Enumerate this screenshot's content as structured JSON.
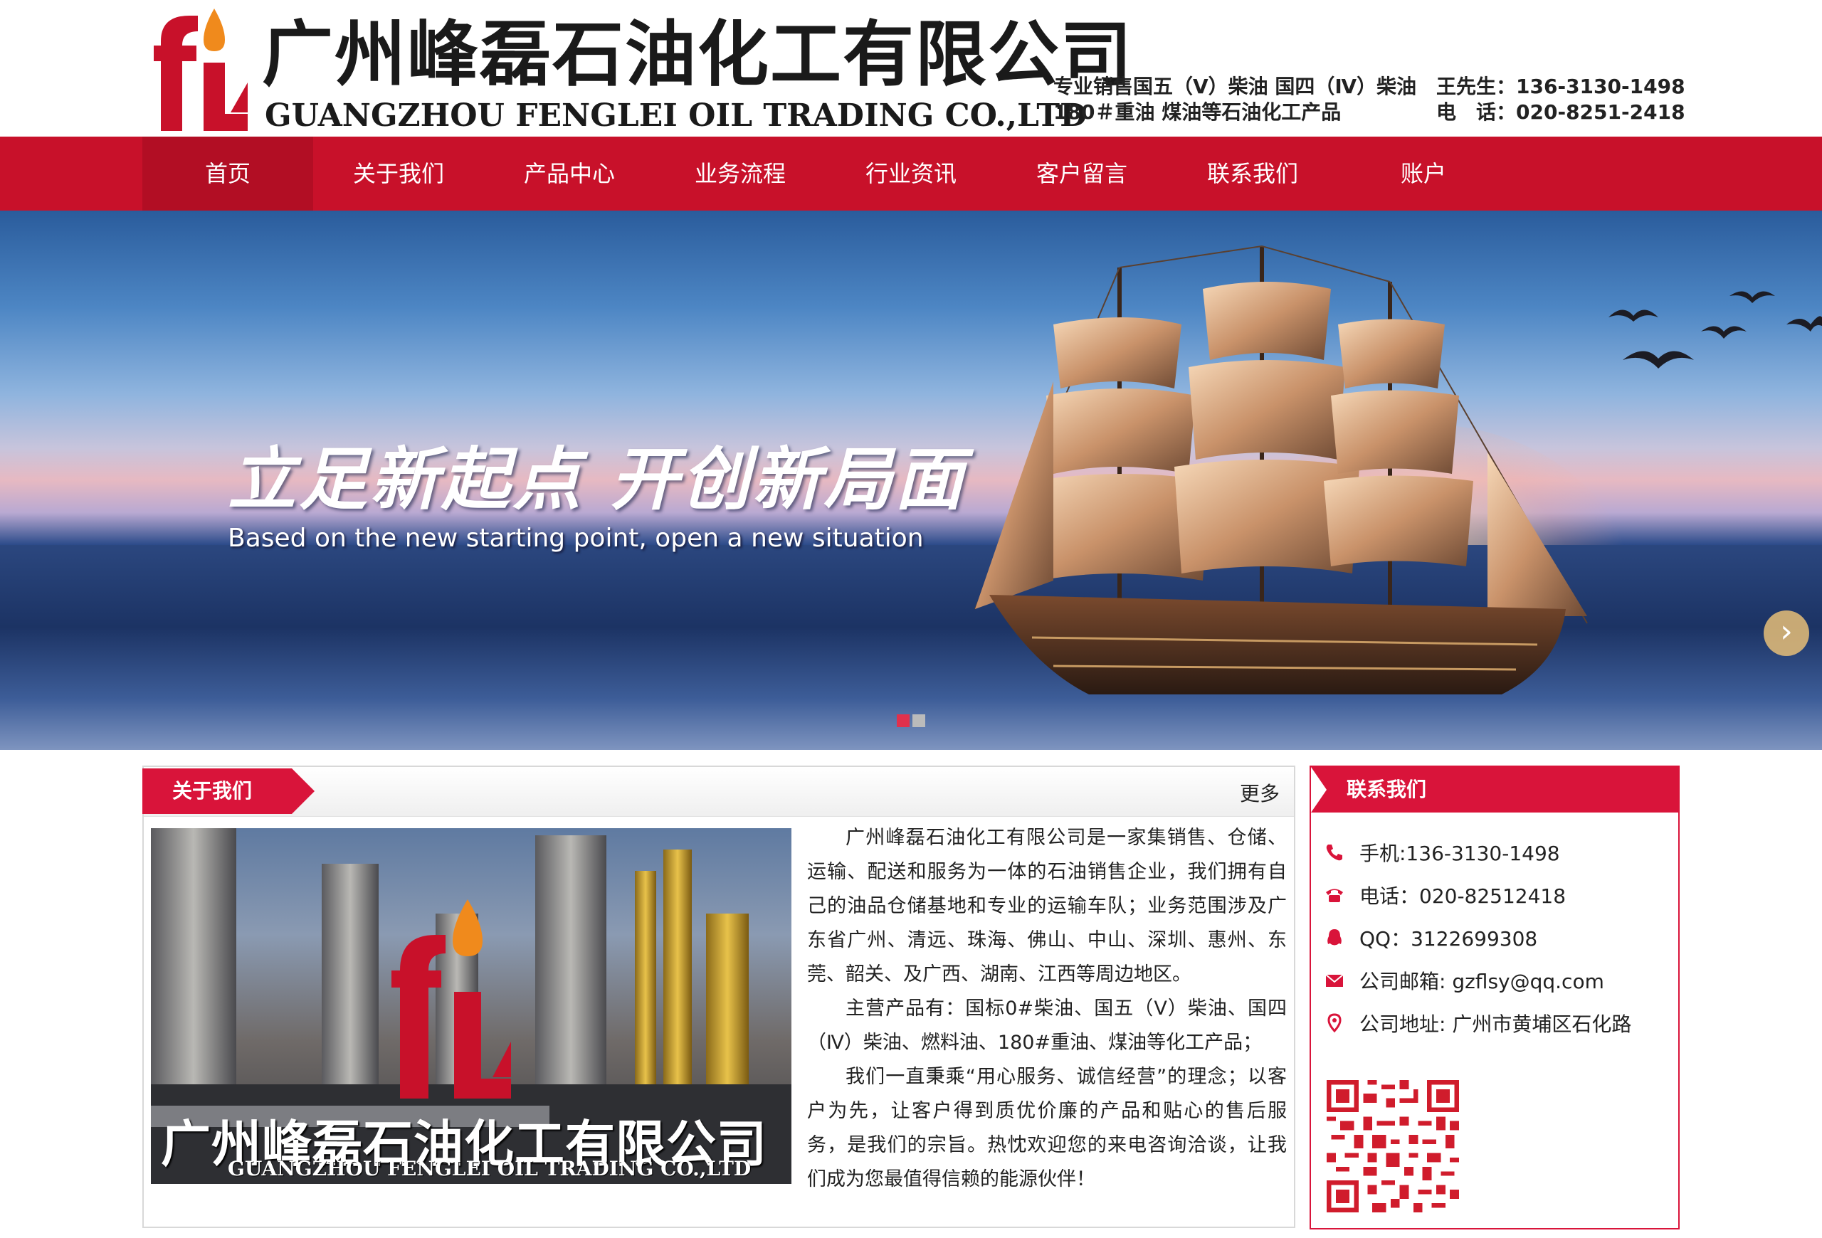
{
  "header": {
    "company_cn": "广州峰磊石油化工有限公司",
    "company_en": "GUANGZHOU FENGLEI OIL TRADING CO.,LTD",
    "tagline_1": "专业销售国五（Ⅴ）柴油 国四（Ⅳ）柴油",
    "tagline_2": "180＃重油 煤油等石油化工产品",
    "contact_1": "王先生：136-3130-1498",
    "contact_2": "电　话：020-8251-2418"
  },
  "nav": {
    "items": [
      {
        "label": "首页"
      },
      {
        "label": "关于我们"
      },
      {
        "label": "产品中心"
      },
      {
        "label": "业务流程"
      },
      {
        "label": "行业资讯"
      },
      {
        "label": "客户留言"
      },
      {
        "label": "联系我们"
      },
      {
        "label": "账户"
      }
    ],
    "active_index": 0
  },
  "banner": {
    "title": "立足新起点  开创新局面",
    "subtitle": "Based on the new starting point, open a new situation",
    "next_arrow_icon": "arrow-right-icon",
    "slide_count": 2,
    "active_slide": 0
  },
  "about": {
    "tab_label": "关于我们",
    "more_label": "更多",
    "image_caption_cn": "广州峰磊石油化工有限公司",
    "image_caption_en": "GUANGZHOU FENGLEI OIL TRADING CO.,LTD",
    "paragraph_1": "广州峰磊石油化工有限公司是一家集销售、仓储、运输、配送和服务为一体的石油销售企业，我们拥有自己的油品仓储基地和专业的运输车队；业务范围涉及广东省广州、清远、珠海、佛山、中山、深圳、惠州、东莞、韶关、及广西、湖南、江西等周边地区。",
    "paragraph_2": "主营产品有：国标0#柴油、国五（Ⅴ）柴油、国四（Ⅳ）柴油、燃料油、180#重油、煤油等化工产品；",
    "paragraph_3": "我们一直秉乘“用心服务、诚信经营”的理念；以客户为先，让客户得到质优价廉的产品和贴心的售后服务，是我们的宗旨。热忱欢迎您的来电咨询洽谈，让我们成为您最值得信赖的能源伙伴！"
  },
  "contact": {
    "title": "联系我们",
    "mobile": "手机:136-3130-1498",
    "phone": "电话：020-82512418",
    "qq": "QQ：3122699308",
    "email": "公司邮箱: gzflsy@qq.com",
    "address": "公司地址: 广州市黄埔区石化路"
  },
  "colors": {
    "brand_red": "#c8112a",
    "accent_red": "#d9143a",
    "logo_orange": "#f08a1c"
  }
}
